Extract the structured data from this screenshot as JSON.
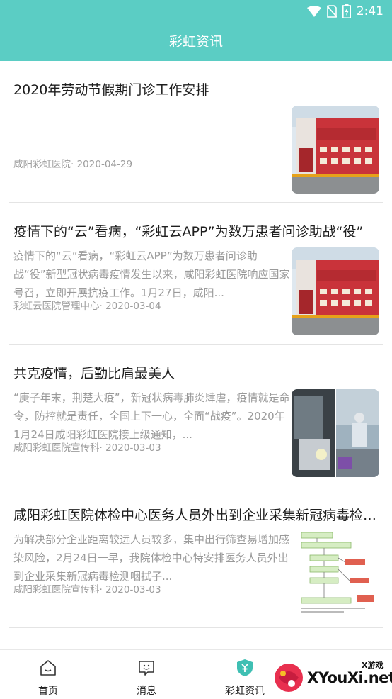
{
  "status_bar": {
    "time": "2:41"
  },
  "header": {
    "title": "彩虹资讯"
  },
  "articles": [
    {
      "title": "2020年劳动节假期门诊工作安排",
      "summary": "",
      "source": "咸阳彩虹医院",
      "date": "2020-04-29",
      "thumbnail": "hospital-building-photo"
    },
    {
      "title": "疫情下的“云”看病，“彩虹云APP”为数万患者问诊助战“役”",
      "summary": "疫情下的“云”看病，“彩虹云APP”为数万患者问诊助战“役”新型冠状病毒疫情发生以来，咸阳彩虹医院响应国家号召，立即开展抗疫工作。1月27日，咸阳...",
      "source": "彩虹云医院管理中心",
      "date": "2020-03-04",
      "thumbnail": "hospital-building-photo"
    },
    {
      "title": "共克疫情，后勤比肩最美人",
      "summary": "“庚子年末，荆楚大疫”，新冠状病毒肺炎肆虐，疫情就是命令，防控就是责任，全国上下一心，全面“战疫”。2020年1月24日咸阳彩虹医院接上级通知，...",
      "source": "咸阳彩虹医院宣传科",
      "date": "2020-03-03",
      "thumbnail": "logistics-staff-photo"
    },
    {
      "title": "咸阳彩虹医院体检中心医务人员外出到企业采集新冠病毒检测咽拭子",
      "summary": "为解决部分企业距离较远人员较多，集中出行筛查易增加感染风险，2月24日一早，我院体检中心特安排医务人员外出到企业采集新冠病毒检测咽拭子...",
      "source": "咸阳彩虹医院宣传科",
      "date": "2020-03-03",
      "thumbnail": "flowchart-image"
    }
  ],
  "tabbar": {
    "items": [
      {
        "label": "首页",
        "icon": "home-icon"
      },
      {
        "label": "消息",
        "icon": "message-icon"
      },
      {
        "label": "彩虹资讯",
        "icon": "shield-news-icon",
        "active": true
      }
    ]
  },
  "watermark": {
    "brand": "XYouXi.net",
    "tag": "X游戏"
  },
  "colors": {
    "accent": "#5bcdc4",
    "active_icon": "#3fbfb3"
  }
}
